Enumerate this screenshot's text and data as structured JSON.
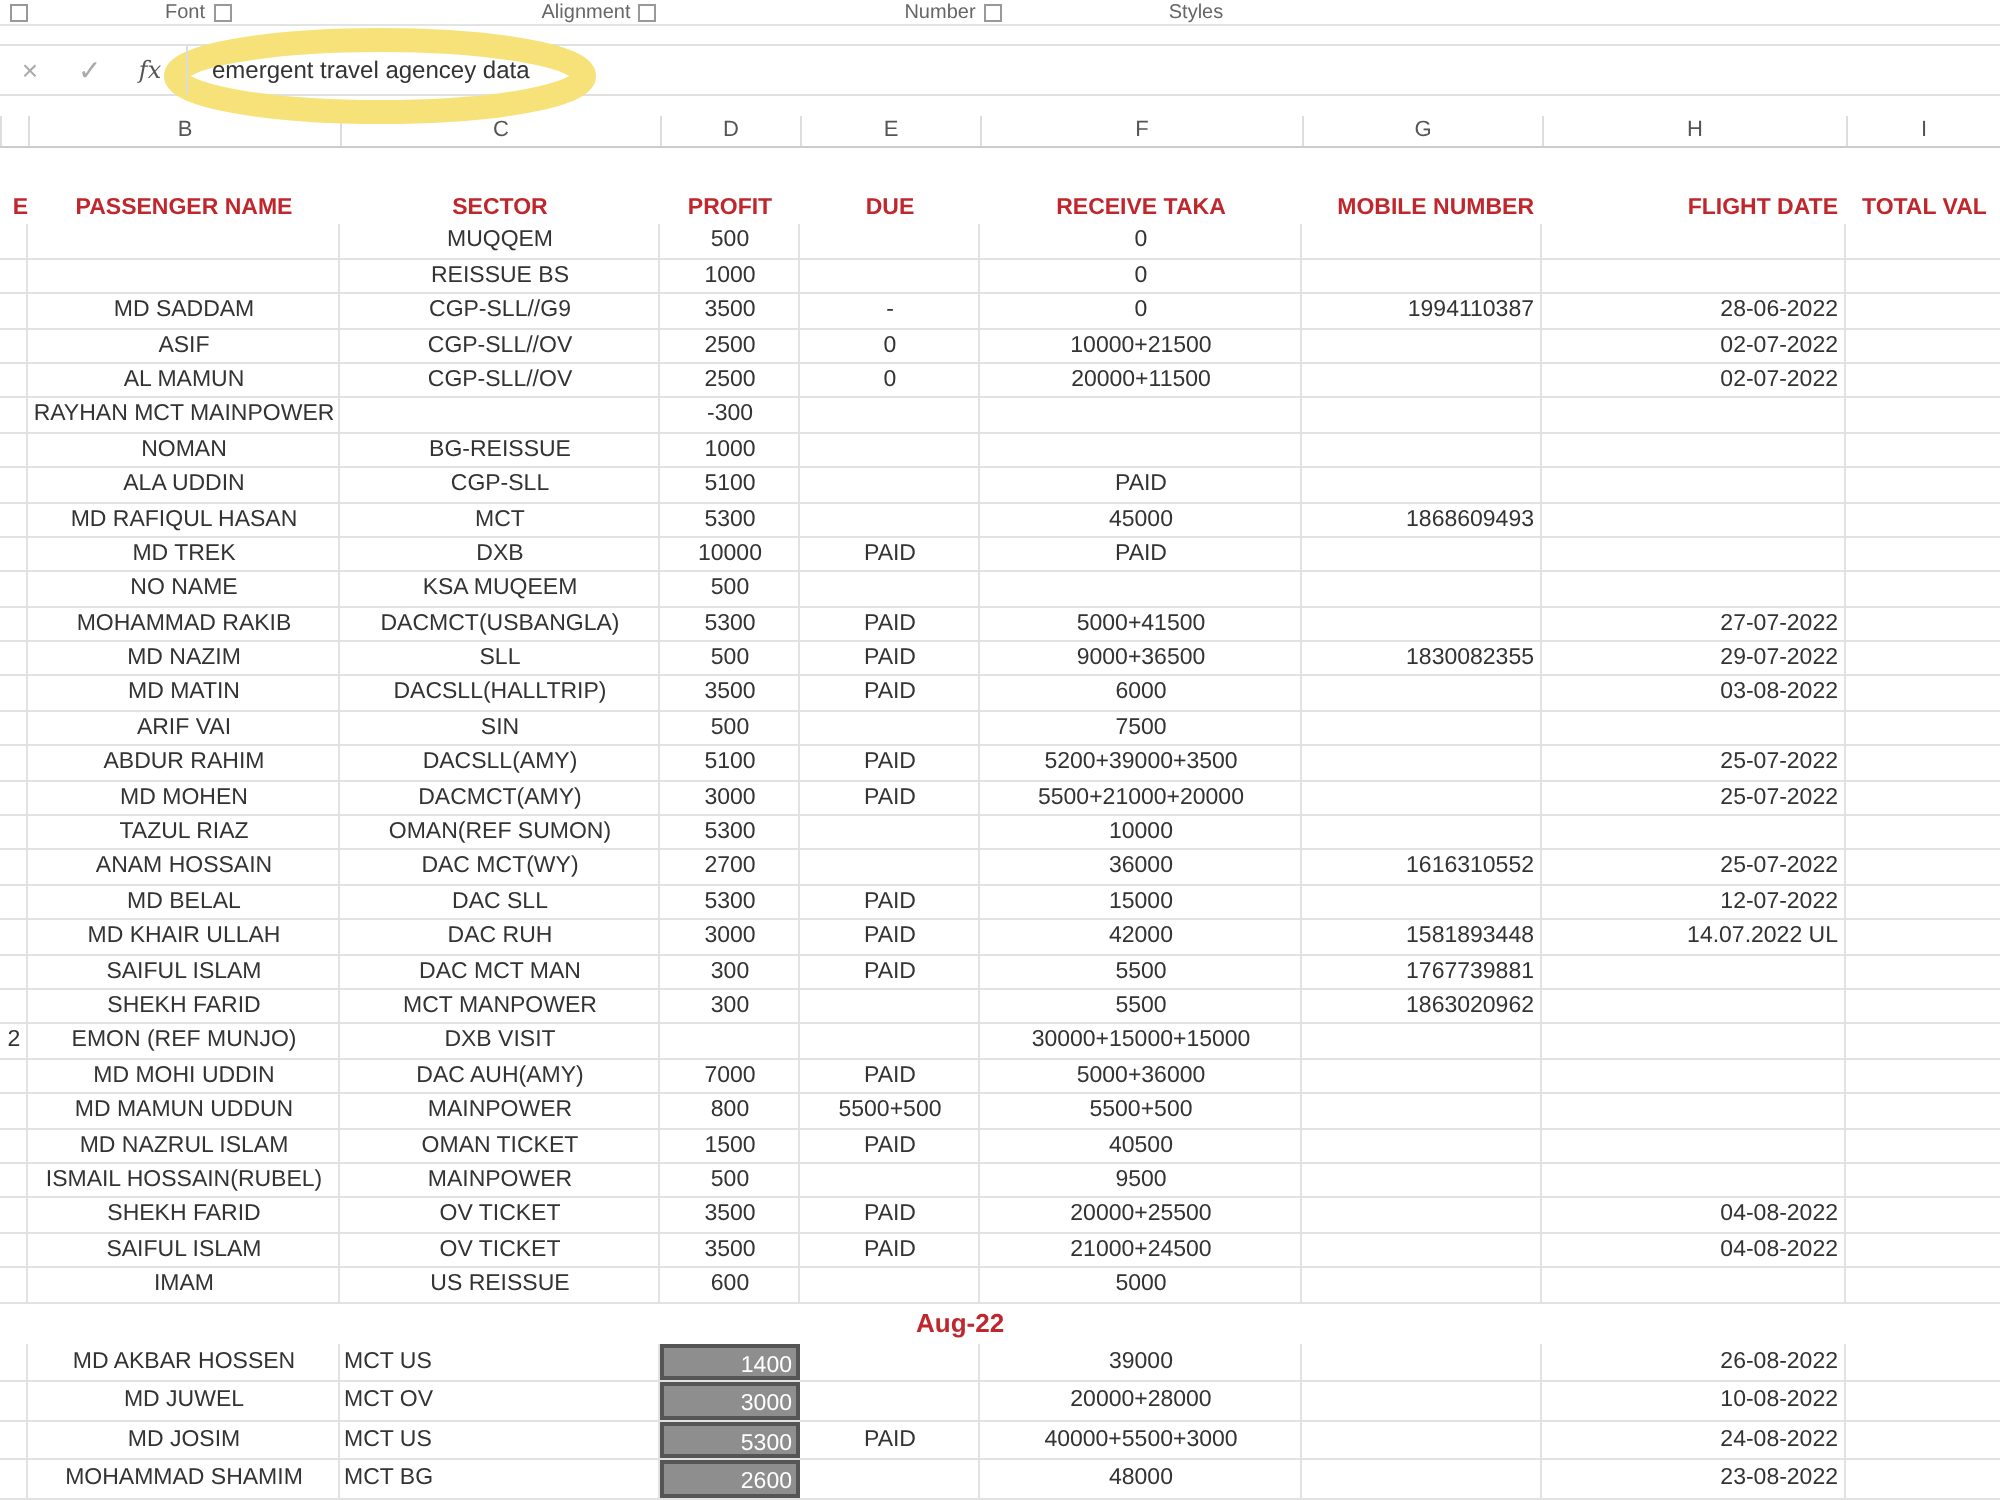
{
  "ribbon_groups": [
    {
      "label": "Font"
    },
    {
      "label": "Alignment"
    },
    {
      "label": "Number"
    },
    {
      "label": "Styles"
    }
  ],
  "formula_bar": {
    "cancel": "×",
    "enter": "✓",
    "function": "fx",
    "value": "emergent travel agencey data"
  },
  "column_letters": [
    "B",
    "C",
    "D",
    "E",
    "F",
    "G",
    "H",
    "I"
  ],
  "table_header": {
    "col_a": "E",
    "passenger_name": "PASSENGER NAME",
    "sector": "SECTOR",
    "profit": "PROFIT",
    "due": "DUE",
    "receive_taka": "RECEIVE TAKA",
    "mobile_number": "MOBILE NUMBER",
    "flight_date": "FLIGHT DATE",
    "column_i": "TOTAL VAL"
  },
  "sections": [
    {
      "kind": "main",
      "rows": [
        {
          "sector": "MUQQEM",
          "profit": "500",
          "receive_taka": "0",
          "profit_selected": false
        },
        {
          "sector": "REISSUE BS",
          "profit": "1000",
          "receive_taka": "0",
          "profit_selected": false
        },
        {
          "passenger_name": "MD SADDAM",
          "sector": "CGP-SLL//G9",
          "profit": "3500",
          "due": "-",
          "receive_taka": "0",
          "mobile_number": "1994110387",
          "flight_date": "28-06-2022",
          "profit_selected": false
        },
        {
          "passenger_name": "ASIF",
          "sector": "CGP-SLL//OV",
          "profit": "2500",
          "due": "0",
          "receive_taka": "10000+21500",
          "flight_date": "02-07-2022",
          "profit_selected": false
        },
        {
          "passenger_name": "AL MAMUN",
          "sector": "CGP-SLL//OV",
          "profit": "2500",
          "due": "0",
          "receive_taka": "20000+11500",
          "flight_date": "02-07-2022",
          "profit_selected": false
        },
        {
          "passenger_name": "RAYHAN MCT  MAINPOWER",
          "profit": "-300",
          "profit_selected": false
        },
        {
          "passenger_name": "NOMAN",
          "sector": "BG-REISSUE",
          "profit": "1000",
          "profit_selected": false
        },
        {
          "passenger_name": "ALA UDDIN",
          "sector": "CGP-SLL",
          "profit": "5100",
          "receive_taka": "PAID",
          "profit_selected": false
        },
        {
          "passenger_name": "MD RAFIQUL HASAN",
          "sector": "MCT",
          "profit": "5300",
          "receive_taka": "45000",
          "mobile_number": "1868609493",
          "profit_selected": false
        },
        {
          "passenger_name": "MD TREK",
          "sector": "DXB",
          "profit": "10000",
          "due": "PAID",
          "receive_taka": "PAID",
          "profit_selected": false
        },
        {
          "passenger_name": "NO NAME",
          "sector": "KSA MUQEEM",
          "profit": "500",
          "profit_selected": false
        },
        {
          "passenger_name": "MOHAMMAD RAKIB",
          "sector": "DACMCT(USBANGLA)",
          "profit": "5300",
          "due": "PAID",
          "receive_taka": "5000+41500",
          "flight_date": "27-07-2022",
          "profit_selected": false
        },
        {
          "passenger_name": "MD NAZIM",
          "sector": "SLL",
          "profit": "500",
          "due": "PAID",
          "receive_taka": "9000+36500",
          "mobile_number": "1830082355",
          "flight_date": "29-07-2022",
          "profit_selected": false
        },
        {
          "passenger_name": "MD MATIN",
          "sector": "DACSLL(HALLTRIP)",
          "profit": "3500",
          "due": "PAID",
          "receive_taka": "6000",
          "flight_date": "03-08-2022",
          "profit_selected": false
        },
        {
          "passenger_name": "ARIF VAI",
          "sector": "SIN",
          "profit": "500",
          "receive_taka": "7500",
          "profit_selected": false
        },
        {
          "passenger_name": "ABDUR RAHIM",
          "sector": "DACSLL(AMY)",
          "profit": "5100",
          "due": "PAID",
          "receive_taka": "5200+39000+3500",
          "flight_date": "25-07-2022",
          "profit_selected": false
        },
        {
          "passenger_name": "MD MOHEN",
          "sector": "DACMCT(AMY)",
          "profit": "3000",
          "due": "PAID",
          "receive_taka": "5500+21000+20000",
          "flight_date": "25-07-2022",
          "profit_selected": false
        },
        {
          "passenger_name": "TAZUL  RIAZ",
          "sector": "OMAN(REF SUMON)",
          "profit": "5300",
          "receive_taka": "10000",
          "profit_selected": false
        },
        {
          "passenger_name": "ANAM HOSSAIN",
          "sector": "DAC MCT(WY)",
          "profit": "2700",
          "receive_taka": "36000",
          "mobile_number": "1616310552",
          "flight_date": "25-07-2022",
          "profit_selected": false
        },
        {
          "passenger_name": "MD BELAL",
          "sector": "DAC SLL",
          "profit": "5300",
          "due": "PAID",
          "receive_taka": "15000",
          "flight_date": "12-07-2022",
          "profit_selected": false
        },
        {
          "passenger_name": "MD KHAIR ULLAH",
          "sector": "DAC RUH",
          "profit": "3000",
          "due": "PAID",
          "receive_taka": "42000",
          "mobile_number": "1581893448",
          "flight_date": "14.07.2022 UL",
          "profit_selected": false
        },
        {
          "passenger_name": "SAIFUL ISLAM",
          "sector": "DAC MCT MAN",
          "profit": "300",
          "due": "PAID",
          "receive_taka": "5500",
          "mobile_number": "1767739881",
          "profit_selected": false
        },
        {
          "passenger_name": "SHEKH FARID",
          "sector": "MCT MANPOWER",
          "profit": "300",
          "receive_taka": "5500",
          "mobile_number": "1863020962",
          "profit_selected": false
        },
        {
          "col_a": "2",
          "passenger_name": "EMON (REF MUNJO)",
          "sector": "DXB VISIT",
          "receive_taka": "30000+15000+15000",
          "profit_selected": false
        },
        {
          "passenger_name": "MD MOHI UDDIN",
          "sector": "DAC AUH(AMY)",
          "profit": "7000",
          "due": "PAID",
          "receive_taka": "5000+36000",
          "profit_selected": false
        },
        {
          "passenger_name": "MD MAMUN UDDUN",
          "sector": "MAINPOWER",
          "profit": "800",
          "due": "5500+500",
          "receive_taka": "5500+500",
          "profit_selected": false
        },
        {
          "passenger_name": "MD NAZRUL ISLAM",
          "sector": "OMAN TICKET",
          "profit": "1500",
          "due": "PAID",
          "receive_taka": "40500",
          "profit_selected": false
        },
        {
          "passenger_name": "ISMAIL HOSSAIN(RUBEL)",
          "sector": "MAINPOWER",
          "profit": "500",
          "receive_taka": "9500",
          "profit_selected": false
        },
        {
          "passenger_name": "SHEKH FARID",
          "sector": "OV TICKET",
          "profit": "3500",
          "due": "PAID",
          "receive_taka": "20000+25500",
          "flight_date": "04-08-2022",
          "profit_selected": false
        },
        {
          "passenger_name": "SAIFUL ISLAM",
          "sector": "OV TICKET",
          "profit": "3500",
          "due": "PAID",
          "receive_taka": "21000+24500",
          "flight_date": "04-08-2022",
          "profit_selected": false
        },
        {
          "passenger_name": "IMAM",
          "sector": "US REISSUE",
          "profit": "600",
          "receive_taka": "5000",
          "profit_selected": false
        }
      ]
    },
    {
      "kind": "month",
      "title": "Aug-22",
      "rows": [
        {
          "passenger_name": "MD AKBAR HOSSEN",
          "sector": "MCT US",
          "profit": "1400",
          "receive_taka": "39000",
          "flight_date": "26-08-2022",
          "profit_selected": true
        },
        {
          "passenger_name": "MD JUWEL",
          "sector": "MCT OV",
          "profit": "3000",
          "receive_taka": "20000+28000",
          "flight_date": "10-08-2022",
          "profit_selected": true
        },
        {
          "passenger_name": "MD JOSIM",
          "sector": "MCT US",
          "profit": "5300",
          "due": "PAID",
          "receive_taka": "40000+5500+3000",
          "flight_date": "24-08-2022",
          "profit_selected": true
        },
        {
          "passenger_name": "MOHAMMAD SHAMIM",
          "sector": "MCT BG",
          "profit": "2600",
          "receive_taka": "48000",
          "flight_date": "23-08-2022",
          "profit_selected": true
        }
      ]
    }
  ]
}
